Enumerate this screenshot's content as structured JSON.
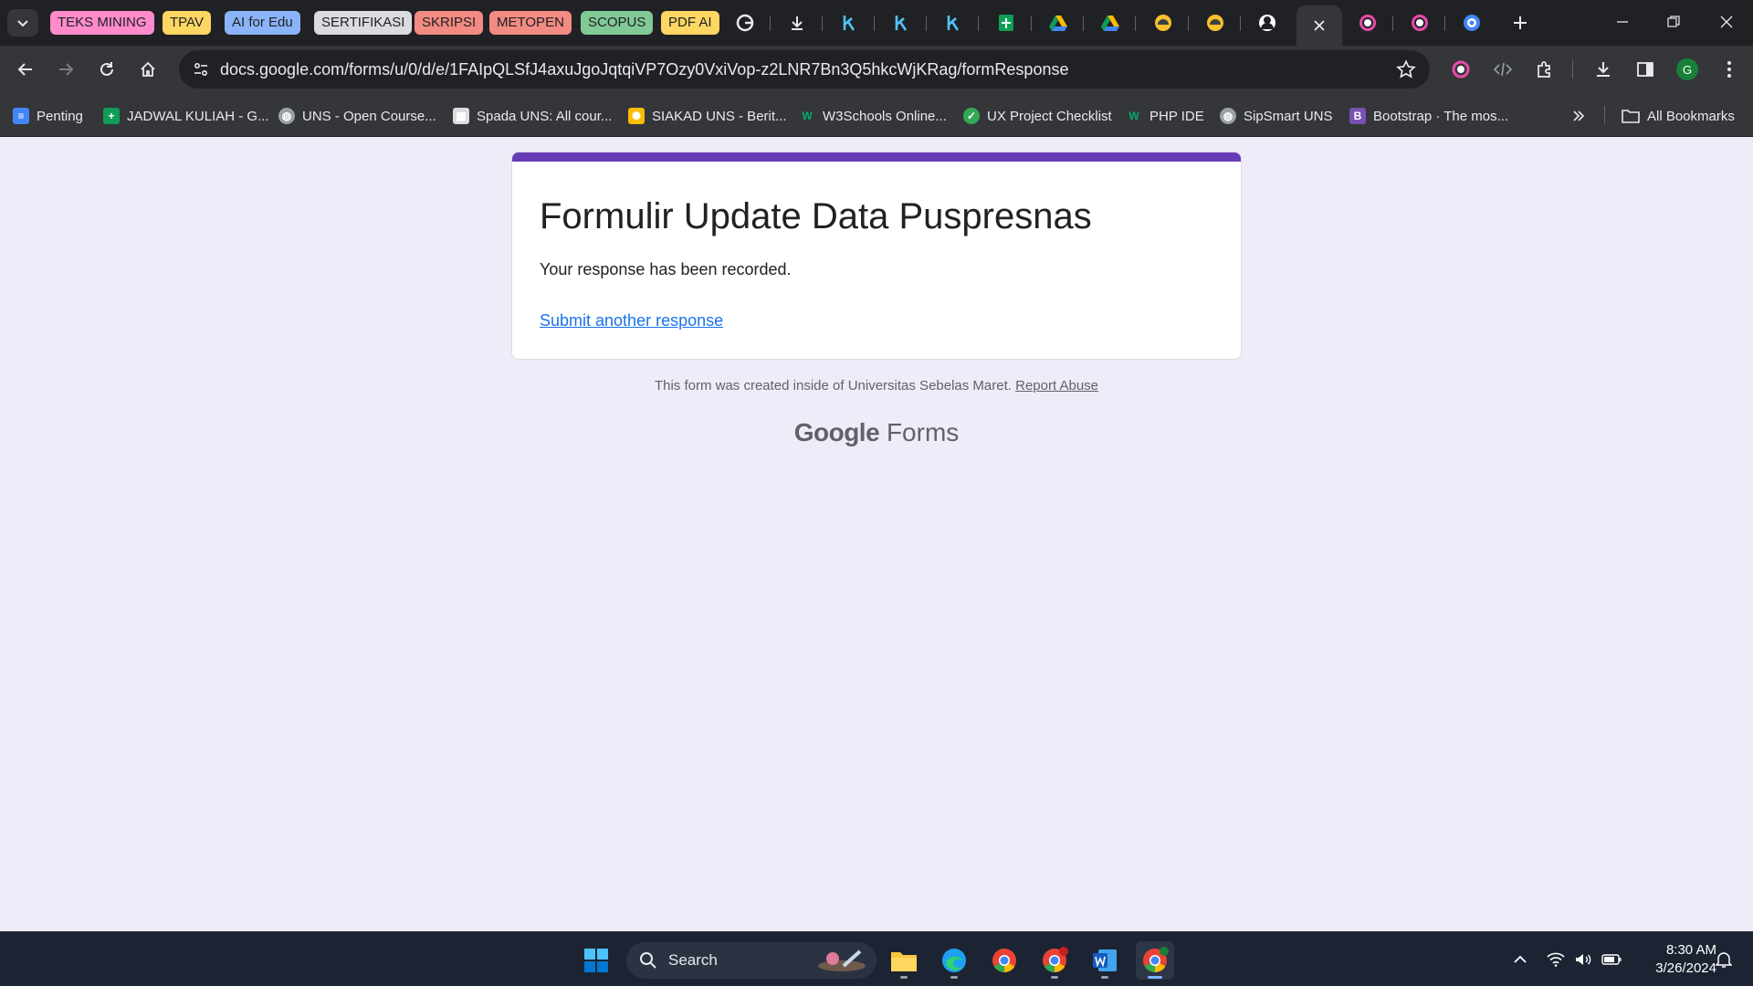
{
  "tab_groups": [
    {
      "label": "TEKS MINING",
      "color": "#ff8bcb"
    },
    {
      "label": "TPAV",
      "color": "#fdd663"
    },
    {
      "label": "AI for Edu",
      "color": "#8ab4f8"
    },
    {
      "label": "SERTIFIKASI",
      "color": "#dadce0"
    },
    {
      "label": "SKRIPSI",
      "color": "#f28b82"
    },
    {
      "label": "METOPEN",
      "color": "#f28b82"
    },
    {
      "label": "SCOPUS",
      "color": "#81c995"
    },
    {
      "label": "PDF AI",
      "color": "#fdd663"
    }
  ],
  "tabs": [
    {
      "icon": "google-icon"
    },
    {
      "icon": "download-icon"
    },
    {
      "icon": "k-icon"
    },
    {
      "icon": "k-icon"
    },
    {
      "icon": "k-icon"
    },
    {
      "icon": "sheets-icon"
    },
    {
      "icon": "drive-icon"
    },
    {
      "icon": "drive-icon"
    },
    {
      "icon": "yellow-app-icon"
    },
    {
      "icon": "yellow-app-icon"
    },
    {
      "icon": "avatar-icon"
    },
    {
      "icon": "close-icon",
      "active": true
    },
    {
      "icon": "ring-icon"
    },
    {
      "icon": "ring-icon"
    },
    {
      "icon": "globe-icon"
    }
  ],
  "toolbar": {
    "url": "docs.google.com/forms/u/0/d/e/1FAIpQLSfJ4axuJgoJqtqiVP7Ozy0VxiVop-z2LNR7Bn3Q5hkcWjKRag/formResponse",
    "profile_initial": "G"
  },
  "bookmarks": [
    {
      "label": "Penting",
      "icon": "docs-icon",
      "color": "#4285f4"
    },
    {
      "label": "JADWAL KULIAH - G...",
      "icon": "sheets-icon",
      "color": "#0f9d58"
    },
    {
      "label": "UNS - Open Course...",
      "icon": "globe-icon",
      "color": "#9aa0a6"
    },
    {
      "label": "Spada UNS: All cour...",
      "icon": "spada-icon",
      "color": "#dadce0"
    },
    {
      "label": "SIAKAD UNS - Berit...",
      "icon": "siakad-icon",
      "color": "#fbbc04"
    },
    {
      "label": "W3Schools Online...",
      "icon": "w3schools-icon",
      "color": "#04aa6d"
    },
    {
      "label": "UX Project Checklist",
      "icon": "check-icon",
      "color": "#34a853"
    },
    {
      "label": "PHP IDE",
      "icon": "w3schools-icon",
      "color": "#04aa6d"
    },
    {
      "label": "SipSmart UNS",
      "icon": "globe-icon",
      "color": "#9aa0a6"
    },
    {
      "label": "Bootstrap · The mos...",
      "icon": "bootstrap-icon",
      "color": "#7952b3"
    }
  ],
  "all_bookmarks_label": "All Bookmarks",
  "form": {
    "title": "Formulir Update Data Puspresnas",
    "confirmation": "Your response has been recorded.",
    "submit_another": "Submit another response",
    "accent_color": "#673ab7"
  },
  "footer": {
    "note": "This form was created inside of Universitas Sebelas Maret.",
    "report_abuse": "Report Abuse",
    "brand_google": "Google",
    "brand_forms": "Forms"
  },
  "taskbar": {
    "search_label": "Search",
    "time": "8:30 AM",
    "date": "3/26/2024"
  }
}
